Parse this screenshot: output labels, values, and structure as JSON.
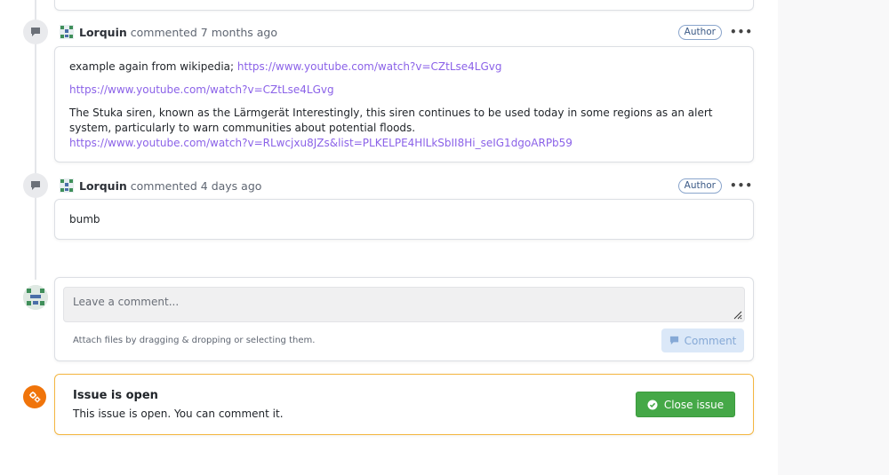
{
  "comments": [
    {
      "author": "Lorquin",
      "action": "commented",
      "time": "7 months ago",
      "badge": "Author",
      "more": "•••",
      "line1_text": "example again from wikipedia; ",
      "line1_link": "https://www.youtube.com/watch?v=CZtLse4LGvg",
      "line2_link": "https://www.youtube.com/watch?v=CZtLse4LGvg",
      "para_text": "The Stuka siren, known as the Lärmgerät Interestingly, this siren continues to be used today in some regions as an alert system, particularly to warn communities about potential floods.",
      "para_link": "https://www.youtube.com/watch?v=RLwcjxu8JZs&list=PLKELPE4HlLkSbII8Hi_seIG1dgoARPb59"
    },
    {
      "author": "Lorquin",
      "action": "commented",
      "time": "4 days ago",
      "badge": "Author",
      "more": "•••",
      "body": "bumb"
    }
  ],
  "composer": {
    "placeholder": "Leave a comment...",
    "attach_hint": "Attach files by dragging & dropping or selecting them.",
    "submit_label": "Comment"
  },
  "issue_status": {
    "title": "Issue is open",
    "description": "This issue is open. You can comment it.",
    "close_label": "Close issue"
  },
  "colors": {
    "link": "#8b62e8",
    "close_button": "#45a847",
    "status_icon": "#f0740a",
    "open_border": "#f4b640"
  },
  "icons": [
    "comment-icon",
    "avatar-icon",
    "more-icon",
    "resize-grip-icon",
    "gear-icon",
    "check-circle-icon"
  ]
}
